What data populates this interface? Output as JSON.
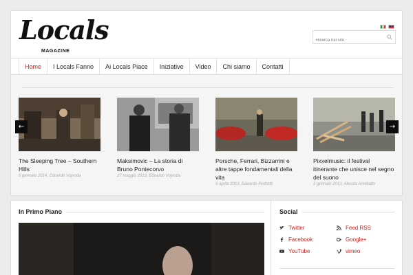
{
  "header": {
    "logo_text": "Locals",
    "logo_sub": "MAGAZINE",
    "search_placeholder": "Ricerca nel sito"
  },
  "nav": {
    "items": [
      "Home",
      "I Locals Fanno",
      "Ai Locals Piace",
      "Iniziative",
      "Video",
      "Chi siamo",
      "Contatti"
    ],
    "active": "Home"
  },
  "slider": {
    "cards": [
      {
        "title": "The Sleeping Tree – Southern Hills",
        "meta": "6 gennaio 2014, Edoardo Vojvoda"
      },
      {
        "title": "Maksimovic – La storia di Bruno Pontecorvo",
        "meta": "27 maggio 2013, Edoardo Vojvoda"
      },
      {
        "title": "Porsche, Ferrari, Bizzarrini e altre tappe fondamentali della vita",
        "meta": "9 aprile 2013, Edoardo Pedrotti"
      },
      {
        "title": "Pixxelmusic: il festival itinerante che unisce nel segno del suono",
        "meta": "2 gennaio 2013, Alessia Anniballo"
      }
    ]
  },
  "primo": {
    "title": "In Primo Piano"
  },
  "social": {
    "title": "Social",
    "links": [
      "Twitter",
      "Feed RSS",
      "Facebook",
      "Google+",
      "YouTube",
      "vimeo"
    ]
  },
  "colors": {
    "accent": "#c8231d",
    "background": "#ececec"
  }
}
